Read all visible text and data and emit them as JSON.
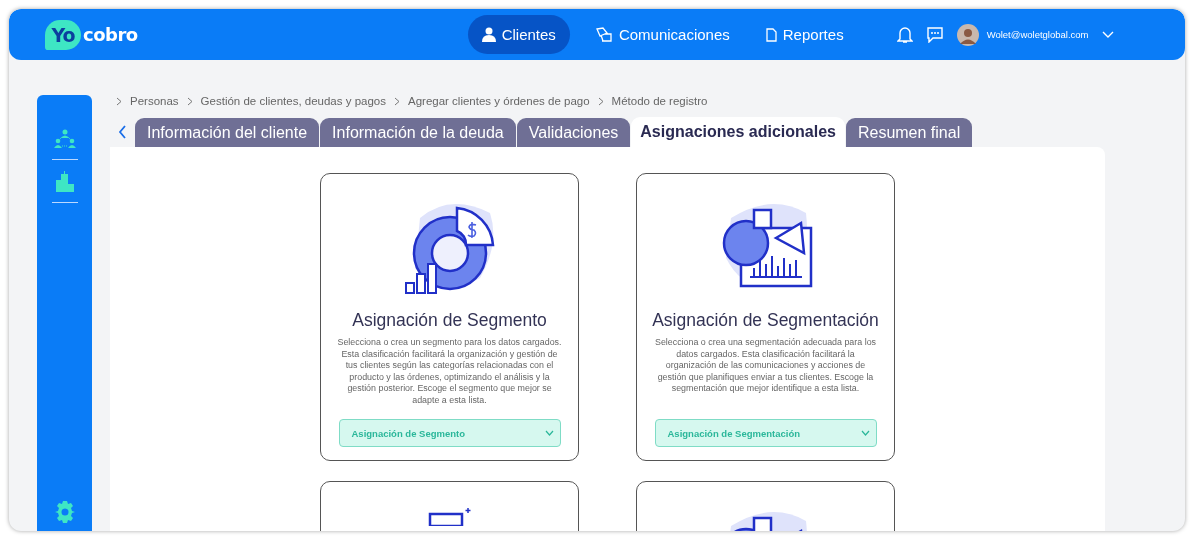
{
  "header": {
    "logo": {
      "mark": "Yo",
      "word": "cobro"
    },
    "nav": [
      {
        "label": "Clientes",
        "selected": true
      },
      {
        "label": "Comunicaciones",
        "selected": false
      },
      {
        "label": "Reportes",
        "selected": false
      }
    ],
    "user": {
      "email": "Wolet@woletglobal.com"
    }
  },
  "breadcrumb": [
    "Personas",
    "Gestión de clientes, deudas y pagos",
    "Agregar clientes y órdenes de pago",
    "Método de registro"
  ],
  "tabs": [
    {
      "label": "Información del cliente",
      "selected": false
    },
    {
      "label": "Información de la deuda",
      "selected": false
    },
    {
      "label": "Validaciones",
      "selected": false
    },
    {
      "label": "Asignaciones adicionales",
      "selected": true
    },
    {
      "label": "Resumen final",
      "selected": false
    }
  ],
  "cards": [
    {
      "kind": "full",
      "title": "Asignación de Segmento",
      "description": "Selecciona o crea un segmento para los datos cargados. Esta clasificación facilitará la organización y gestión de tus clientes según las categorías relacionadas con el producto y las órdenes, optimizando el análisis y la gestión posterior.  Escoge el segmento que mejor se adapte a esta lista.",
      "value": "Asignación de Segmento"
    },
    {
      "kind": "full",
      "title": "Asignación de Segmentación",
      "description": "Selecciona o crea una segmentación adecuada para los datos cargados. Esta clasificación facilitará la organización de las comunicaciones y acciones de gestión que planifiques enviar a tus clientes. Escoge la segmentación que mejor identifique a esta lista.",
      "value": "Asignación de Segmentación"
    },
    {
      "kind": "cut"
    },
    {
      "kind": "cut"
    }
  ]
}
